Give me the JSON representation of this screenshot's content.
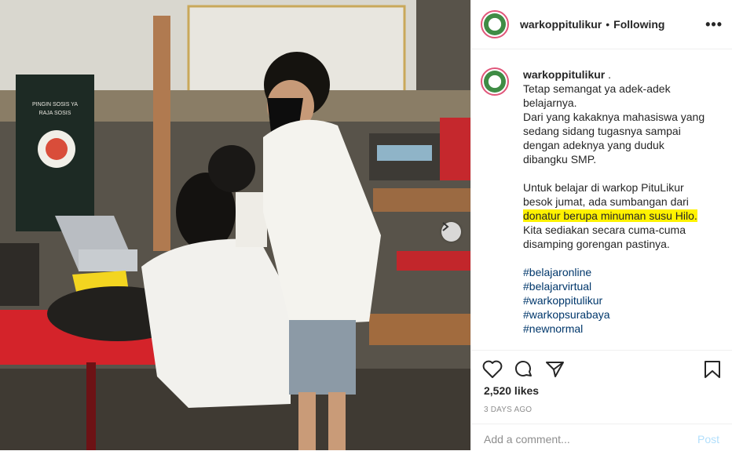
{
  "photo": {
    "poster_text": [
      "PINGIN SOSIS YA",
      "RAJA SOSIS"
    ],
    "description": "Students in white shirts studying at a warung table"
  },
  "header": {
    "username": "warkoppitulikur",
    "separator": "•",
    "follow_status": "Following",
    "more_icon": "more-options-icon"
  },
  "caption": {
    "username": "warkoppitulikur",
    "username_suffix": " .",
    "lines": [
      "Tetap semangat ya adek-adek",
      "belajarnya.",
      "Dari yang kakaknya mahasiswa yang",
      "sedang sidang tugasnya sampai",
      "dengan adeknya yang duduk",
      "dibangku SMP."
    ],
    "para2_lines": [
      "Untuk belajar di warkop PituLikur",
      "besok jumat, ada sumbangan dari"
    ],
    "highlight_line": "donatur berupa minuman susu Hilo.",
    "para2_after": [
      "Kita sediakan secara cuma-cuma",
      "disamping gorengan pastinya."
    ],
    "hashtags": [
      "#belajaronline",
      "#belajarvirtual",
      "#warkoppitulikur",
      "#warkopsurabaya",
      "#newnormal"
    ]
  },
  "actions": {
    "icons": [
      "heart-icon",
      "comment-icon",
      "share-icon",
      "bookmark-icon"
    ]
  },
  "likes": "2,520 likes",
  "date": "3 DAYS AGO",
  "comment_box": {
    "placeholder": "Add a comment...",
    "post_label": "Post"
  },
  "colors": {
    "highlight": "#fff200",
    "hashtag": "#00376b",
    "post_disabled": "#b2dffc",
    "avatar_ring": "#e0567a"
  }
}
